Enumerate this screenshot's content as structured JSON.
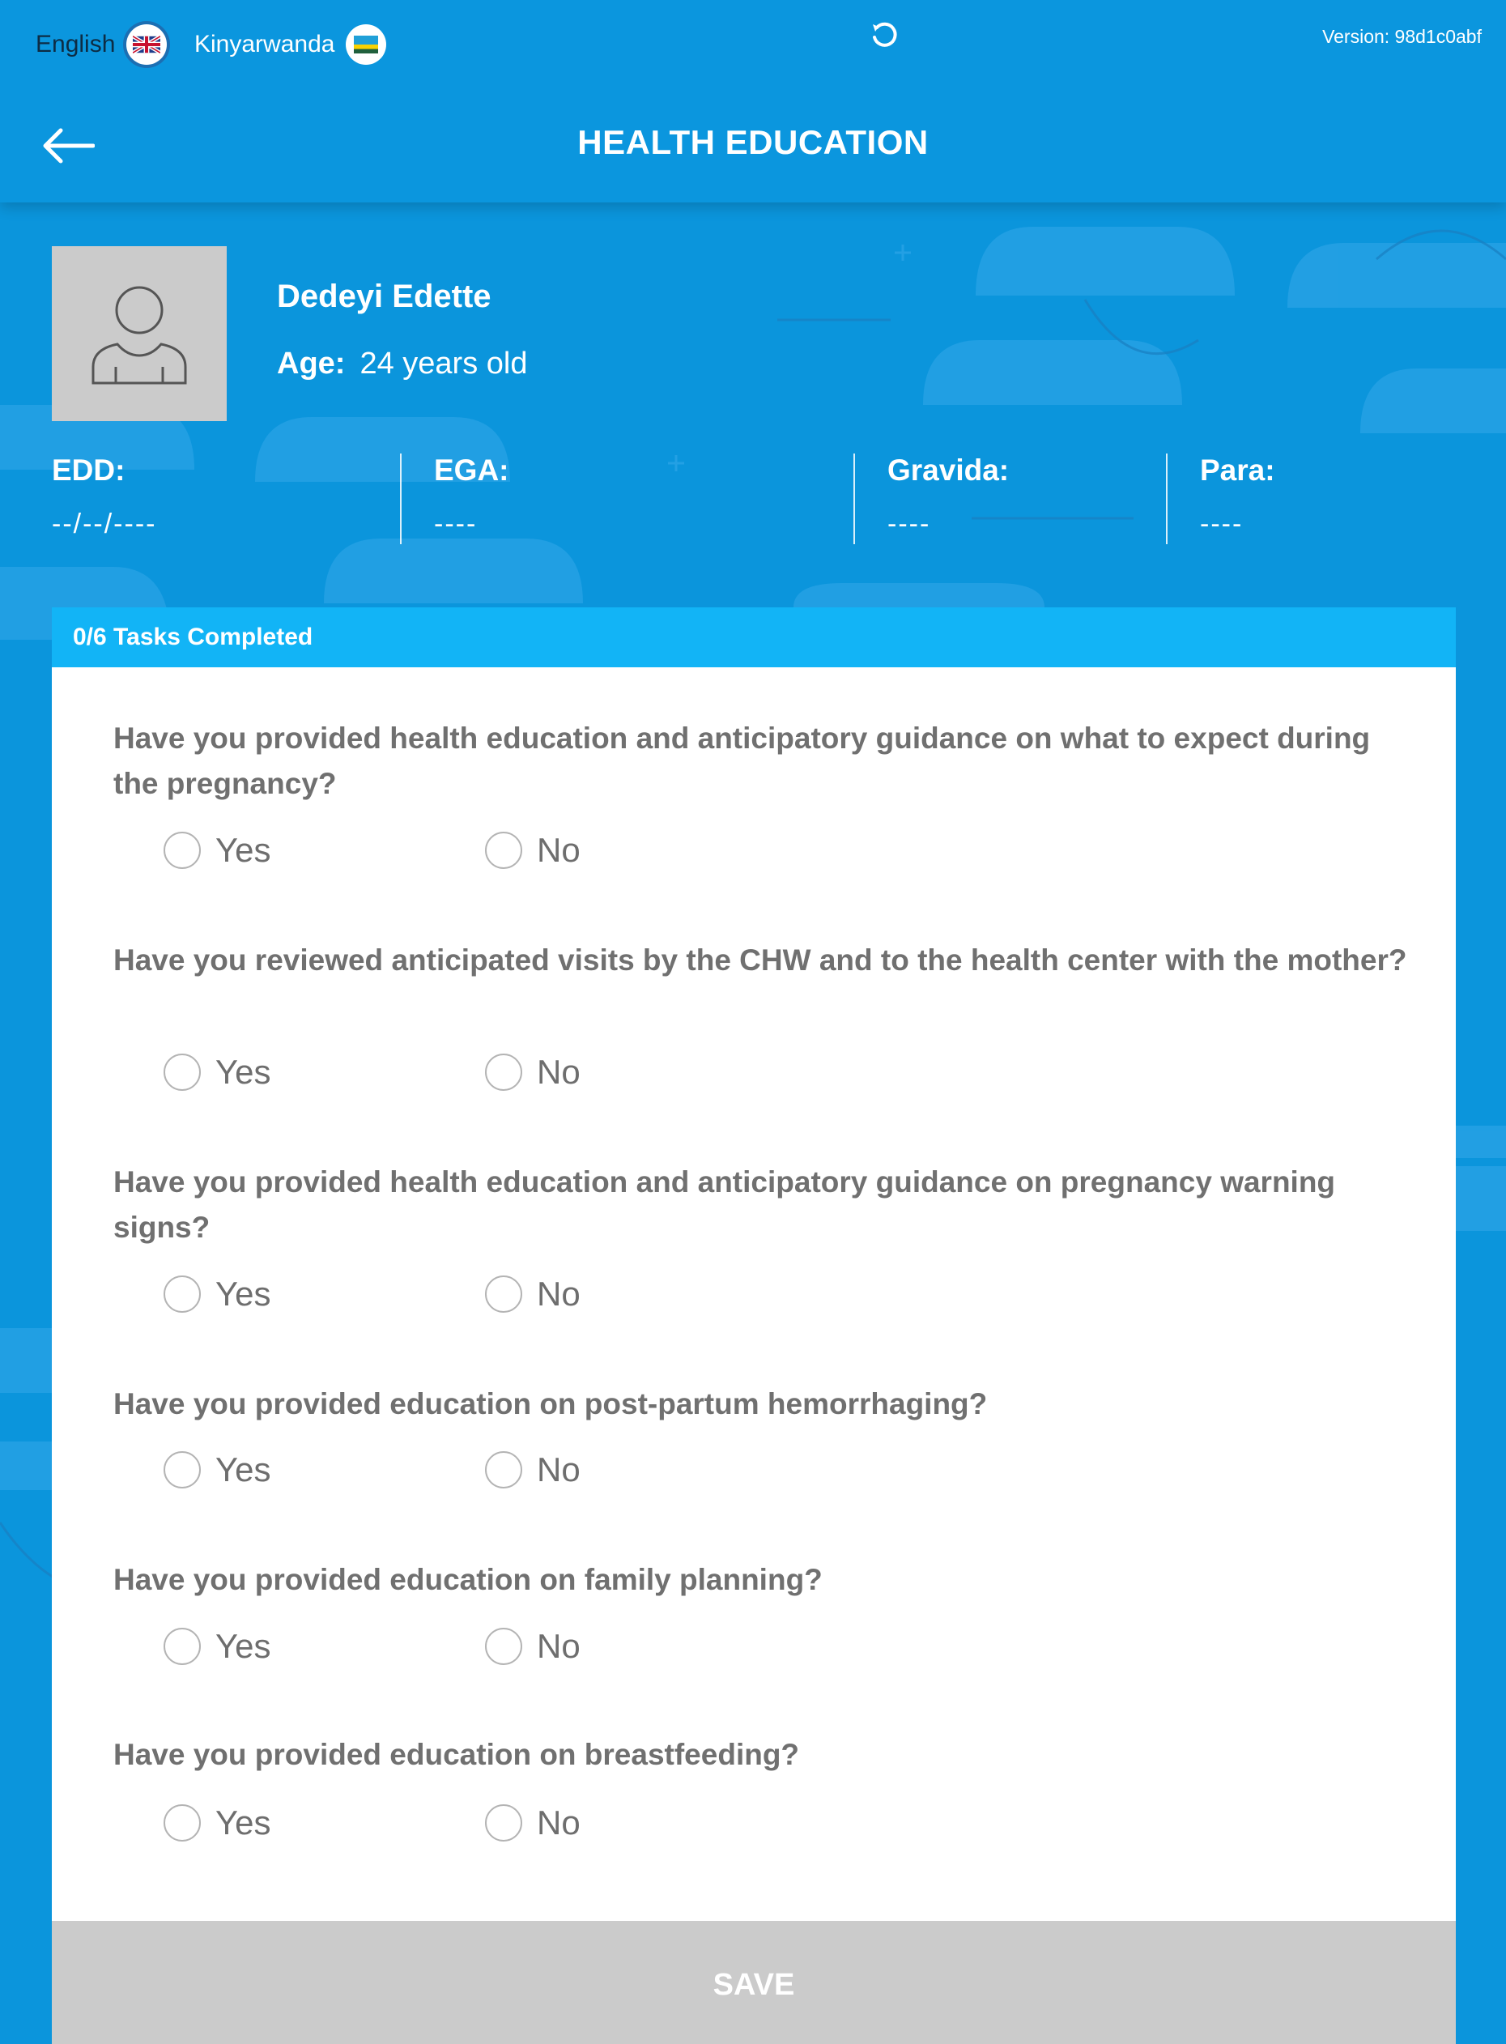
{
  "header": {
    "languages": [
      {
        "label": "English",
        "flag": "uk-flag-icon",
        "selected": true
      },
      {
        "label": "Kinyarwanda",
        "flag": "rwanda-flag-icon",
        "selected": false
      }
    ],
    "version": "Version: 98d1c0abf",
    "title": "HEALTH EDUCATION"
  },
  "patient": {
    "name": "Dedeyi Edette",
    "age_label": "Age:",
    "age_value": "24 years old"
  },
  "stats": [
    {
      "label": "EDD:",
      "value": "--/--/----"
    },
    {
      "label": "EGA:",
      "value": "----"
    },
    {
      "label": "Gravida:",
      "value": "----"
    },
    {
      "label": "Para:",
      "value": "----"
    }
  ],
  "card": {
    "progress": "0/6 Tasks Completed",
    "questions": [
      {
        "text": "Have you provided health education and anticipatory guidance on what to expect during the pregnancy?",
        "yes": "Yes",
        "no": "No"
      },
      {
        "text": "Have you reviewed anticipated visits by the CHW and to the health center with the mother?",
        "yes": "Yes",
        "no": "No"
      },
      {
        "text": "Have you provided health education and anticipatory guidance on pregnancy warning signs?",
        "yes": "Yes",
        "no": "No"
      },
      {
        "text": "Have you provided education on post-partum hemorrhaging?",
        "yes": "Yes",
        "no": "No"
      },
      {
        "text": "Have you provided education on family planning?",
        "yes": "Yes",
        "no": "No"
      },
      {
        "text": "Have you provided education on breastfeeding?",
        "yes": "Yes",
        "no": "No"
      }
    ],
    "save_label": "SAVE"
  },
  "colors": {
    "background": "#0b95dc",
    "progress_bar": "#12b4f6",
    "save_disabled": "#cbcbcb",
    "question_text": "#707070"
  }
}
